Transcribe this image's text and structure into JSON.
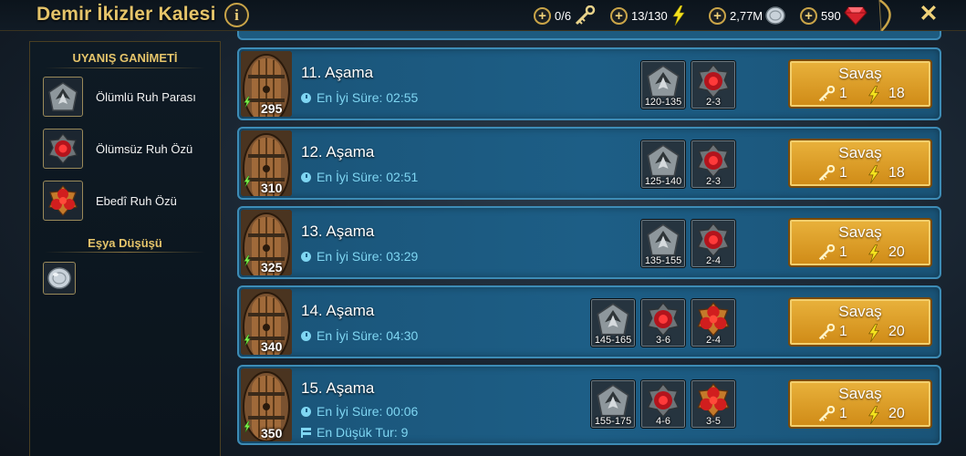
{
  "header": {
    "title": "Demir İkizler Kalesi",
    "info_icon": "info-icon",
    "info_glyph": "i",
    "resources": [
      {
        "name": "keys",
        "value": "0/6",
        "icon": "key-icon"
      },
      {
        "name": "energy",
        "value": "13/130",
        "icon": "energy-bolt-icon"
      },
      {
        "name": "silver",
        "value": "2,77M",
        "icon": "silver-coin-icon"
      },
      {
        "name": "gems",
        "value": "590",
        "icon": "ruby-gem-icon"
      }
    ],
    "plus_glyph": "+",
    "close_glyph": "✕"
  },
  "left_panel": {
    "heading": "UYANIŞ GANİMETİ",
    "items": [
      {
        "label": "Ölümlü Ruh Parası",
        "icon": "mortal-soul-coin-icon"
      },
      {
        "label": "Ölümsüz Ruh Özü",
        "icon": "immortal-soul-essence-icon"
      },
      {
        "label": "Ebedî Ruh Özü",
        "icon": "eternal-soul-essence-icon"
      }
    ],
    "item_drop_heading": "Eşya Düşüşü",
    "item_drop_icon": "silver-coin-icon"
  },
  "stages": [
    {
      "name": "11. Aşama",
      "power": "295",
      "best_time": "En İyi Süre: 02:55",
      "drops": [
        {
          "type": "mortal",
          "range": "120-135"
        },
        {
          "type": "immortal",
          "range": "2-3"
        }
      ],
      "fight": {
        "label": "Savaş",
        "keys": "1",
        "energy": "18"
      }
    },
    {
      "name": "12. Aşama",
      "power": "310",
      "best_time": "En İyi Süre: 02:51",
      "drops": [
        {
          "type": "mortal",
          "range": "125-140"
        },
        {
          "type": "immortal",
          "range": "2-3"
        }
      ],
      "fight": {
        "label": "Savaş",
        "keys": "1",
        "energy": "18"
      }
    },
    {
      "name": "13. Aşama",
      "power": "325",
      "best_time": "En İyi Süre: 03:29",
      "drops": [
        {
          "type": "mortal",
          "range": "135-155"
        },
        {
          "type": "immortal",
          "range": "2-4"
        }
      ],
      "fight": {
        "label": "Savaş",
        "keys": "1",
        "energy": "20"
      }
    },
    {
      "name": "14. Aşama",
      "power": "340",
      "best_time": "En İyi Süre: 04:30",
      "drops": [
        {
          "type": "mortal",
          "range": "145-165"
        },
        {
          "type": "immortal",
          "range": "3-6"
        },
        {
          "type": "eternal",
          "range": "2-4"
        }
      ],
      "fight": {
        "label": "Savaş",
        "keys": "1",
        "energy": "20"
      }
    },
    {
      "name": "15. Aşama",
      "power": "350",
      "best_time": "En İyi Süre: 00:06",
      "min_turns": "En Düşük Tur: 9",
      "drops": [
        {
          "type": "mortal",
          "range": "155-175"
        },
        {
          "type": "immortal",
          "range": "4-6"
        },
        {
          "type": "eternal",
          "range": "3-5"
        }
      ],
      "fight": {
        "label": "Savaş",
        "keys": "1",
        "energy": "20"
      }
    }
  ],
  "colors": {
    "gold": "#e5c46a",
    "stage_bg": "#1d5e86",
    "fight_button": "#e0a02c",
    "time_text": "#7fd6f2",
    "energy": "#f4e21e"
  }
}
